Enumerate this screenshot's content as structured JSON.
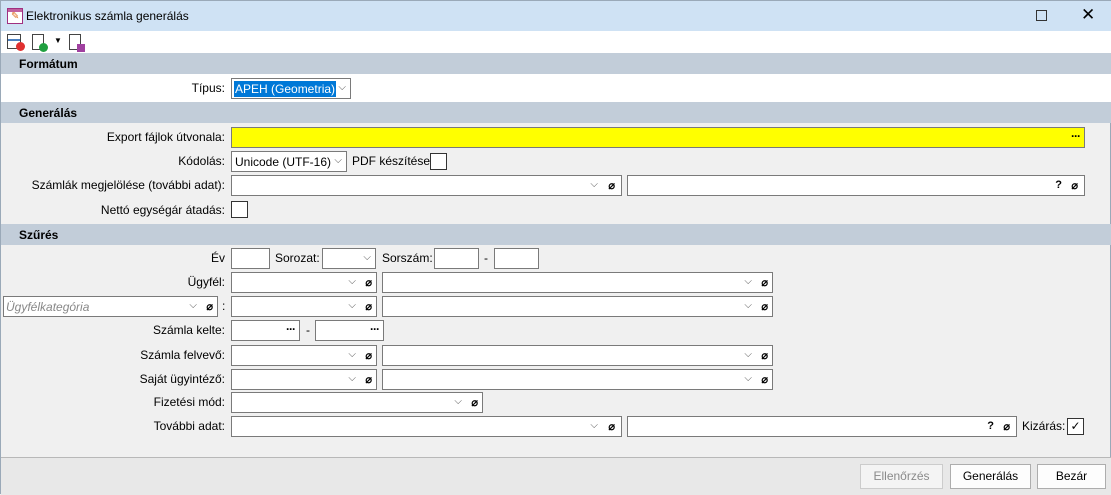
{
  "window": {
    "title": "Elektronikus számla generálás",
    "maximize_icon": "maximize-icon",
    "close_icon": "close-icon"
  },
  "toolbar": {
    "icons": [
      "clear-form-icon",
      "load-checklist-icon",
      "dropdown-arrow-icon",
      "save-checklist-icon"
    ]
  },
  "sections": {
    "format": "Formátum",
    "generate": "Generálás",
    "filter": "Szűrés"
  },
  "format": {
    "type_label": "Típus:",
    "type_value": "APEH (Geometria)"
  },
  "generate": {
    "export_path_label": "Export fájlok útvonala:",
    "export_path_value": "",
    "export_path_color": "#ffff00",
    "encoding_label": "Kódolás:",
    "encoding_value": "Unicode (UTF-16)",
    "pdf_label": "PDF készítése:",
    "pdf_checked": false,
    "invoice_mark_label": "Számlák megjelölése (további adat):",
    "net_unit_label": "Nettó egységár átadás:",
    "net_unit_checked": false
  },
  "filter": {
    "year_label": "Év",
    "series_label": "Sorozat:",
    "number_label": "Sorszám:",
    "dash": "-",
    "customer_label": "Ügyfél:",
    "category_placeholder": "Ügyfélkategória",
    "colon": ":",
    "date_label": "Számla kelte:",
    "recorder_label": "Számla felvevő:",
    "agent_label": "Saját ügyintéző:",
    "payment_label": "Fizetési mód:",
    "extra_label": "További adat:",
    "exclude_label": "Kizárás:",
    "exclude_checked": true,
    "check_mark": "✓",
    "question": "?",
    "dots": "···",
    "chevron": "⌵",
    "clip": "𝟎"
  },
  "buttons": {
    "check": "Ellenőrzés",
    "check_disabled": true,
    "generate": "Generálás",
    "close": "Bezár"
  }
}
